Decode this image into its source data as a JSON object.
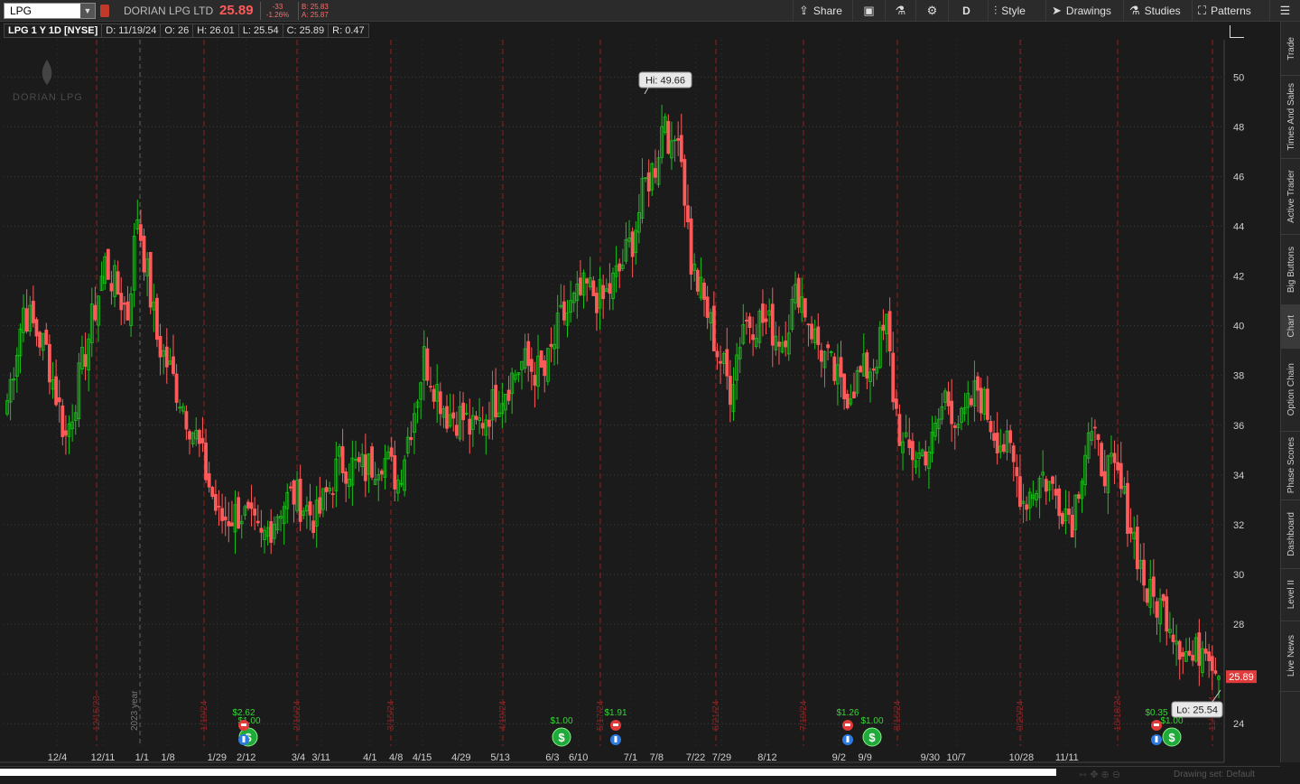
{
  "toolbar": {
    "symbol": "LPG",
    "company": "DORIAN LPG LTD",
    "last": "25.89",
    "change": "-33",
    "change_pct": "-1.26%",
    "bid": "B: 25.83",
    "ask": "A: 25.87",
    "share_label": "Share",
    "period_label": "D",
    "style_label": "Style",
    "drawings_label": "Drawings",
    "studies_label": "Studies",
    "patterns_label": "Patterns"
  },
  "header": {
    "title": "LPG 1 Y 1D [NYSE]",
    "date": "D: 11/19/24",
    "open": "O: 26",
    "high": "H: 26.01",
    "low": "L: 25.54",
    "close": "C: 25.89",
    "range": "R: 0.47"
  },
  "side_tabs": [
    "Trade",
    "Times And Sales",
    "Active Trader",
    "Big Buttons",
    "Chart",
    "Option Chain",
    "Phase Scores",
    "Dashboard",
    "Level II",
    "Live News"
  ],
  "footer": {
    "drawing_set": "Drawing set: Default"
  },
  "watermark": "DORIAN LPG",
  "colors": {
    "up": "#19c219",
    "down": "#ff5a5a",
    "background": "#1b1b1b",
    "marker_line": "#b32020"
  },
  "chart_data": {
    "type": "candlestick",
    "y_ticks": [
      24,
      26,
      28,
      30,
      32,
      34,
      36,
      38,
      40,
      42,
      44,
      46,
      48,
      50
    ],
    "ylim": [
      23.1,
      51.5
    ],
    "grid": true,
    "x_ticks": [
      "12/4",
      "12/11",
      "1/1",
      "1/8",
      "1/29",
      "2/12",
      "3/4",
      "3/11",
      "4/1",
      "4/8",
      "4/15",
      "4/29",
      "5/13",
      "6/3",
      "6/10",
      "7/1",
      "7/8",
      "7/22",
      "7/29",
      "8/12",
      "9/2",
      "9/9",
      "9/30",
      "10/7",
      "10/28",
      "11/11"
    ],
    "year_label": "2023 year",
    "event_dates": [
      "12/15/23",
      "1/19/24",
      "2/16/24",
      "3/15/24",
      "4/19/24",
      "5/17/24",
      "6/21/24",
      "7/19/24",
      "8/16/24",
      "9/20/24",
      "10/18/24",
      "11/15/24"
    ],
    "high_label": "Hi: 49.66",
    "low_label": "Lo: 25.54",
    "last_label": "25.89",
    "dividends": [
      "$2.62",
      "$1.00",
      "$1.00",
      "$1.91",
      "$1.26",
      "$1.00",
      "$0.35",
      "$1.00"
    ],
    "anchors": [
      [
        0,
        37
      ],
      [
        5,
        40.7
      ],
      [
        12,
        39
      ],
      [
        18,
        35.5
      ],
      [
        22,
        37.8
      ],
      [
        30,
        42.5
      ],
      [
        37,
        40.5
      ],
      [
        40,
        44.5
      ],
      [
        46,
        39.5
      ],
      [
        52,
        37.5
      ],
      [
        58,
        35.5
      ],
      [
        65,
        32.2
      ],
      [
        72,
        32.5
      ],
      [
        78,
        31.3
      ],
      [
        84,
        32.8
      ],
      [
        88,
        33.2
      ],
      [
        95,
        32.2
      ],
      [
        102,
        34.5
      ],
      [
        110,
        34.2
      ],
      [
        115,
        34.8
      ],
      [
        120,
        33.8
      ],
      [
        125,
        36.7
      ],
      [
        128,
        38.7
      ],
      [
        135,
        36.5
      ],
      [
        140,
        36.3
      ],
      [
        143,
        35.7
      ],
      [
        150,
        37
      ],
      [
        158,
        38.5
      ],
      [
        165,
        38
      ],
      [
        170,
        40.2
      ],
      [
        178,
        41.5
      ],
      [
        183,
        41
      ],
      [
        188,
        42.2
      ],
      [
        192,
        43.5
      ],
      [
        196,
        45.7
      ],
      [
        199,
        46.5
      ],
      [
        202,
        48.7
      ],
      [
        204,
        46.7
      ],
      [
        206,
        48.2
      ],
      [
        210,
        42.5
      ],
      [
        215,
        40.5
      ],
      [
        218,
        39
      ],
      [
        222,
        37.5
      ],
      [
        226,
        40.2
      ],
      [
        232,
        40.2
      ],
      [
        238,
        39.5
      ],
      [
        243,
        41.5
      ],
      [
        248,
        39.5
      ],
      [
        252,
        38.5
      ],
      [
        257,
        37.2
      ],
      [
        262,
        38
      ],
      [
        266,
        38.5
      ],
      [
        270,
        40
      ],
      [
        272,
        37.3
      ],
      [
        275,
        35
      ],
      [
        280,
        34.8
      ],
      [
        284,
        35.2
      ],
      [
        288,
        37.2
      ],
      [
        293,
        36
      ],
      [
        298,
        37.5
      ],
      [
        303,
        35.8
      ],
      [
        308,
        34.8
      ],
      [
        312,
        33
      ],
      [
        318,
        34
      ],
      [
        322,
        33.2
      ],
      [
        327,
        32.3
      ],
      [
        332,
        35.8
      ],
      [
        336,
        34.5
      ],
      [
        341,
        33.8
      ],
      [
        346,
        31.5
      ],
      [
        350,
        29.2
      ],
      [
        356,
        28.5
      ],
      [
        360,
        27.3
      ],
      [
        364,
        26.5
      ],
      [
        368,
        27.5
      ],
      [
        372,
        25.9
      ]
    ]
  }
}
